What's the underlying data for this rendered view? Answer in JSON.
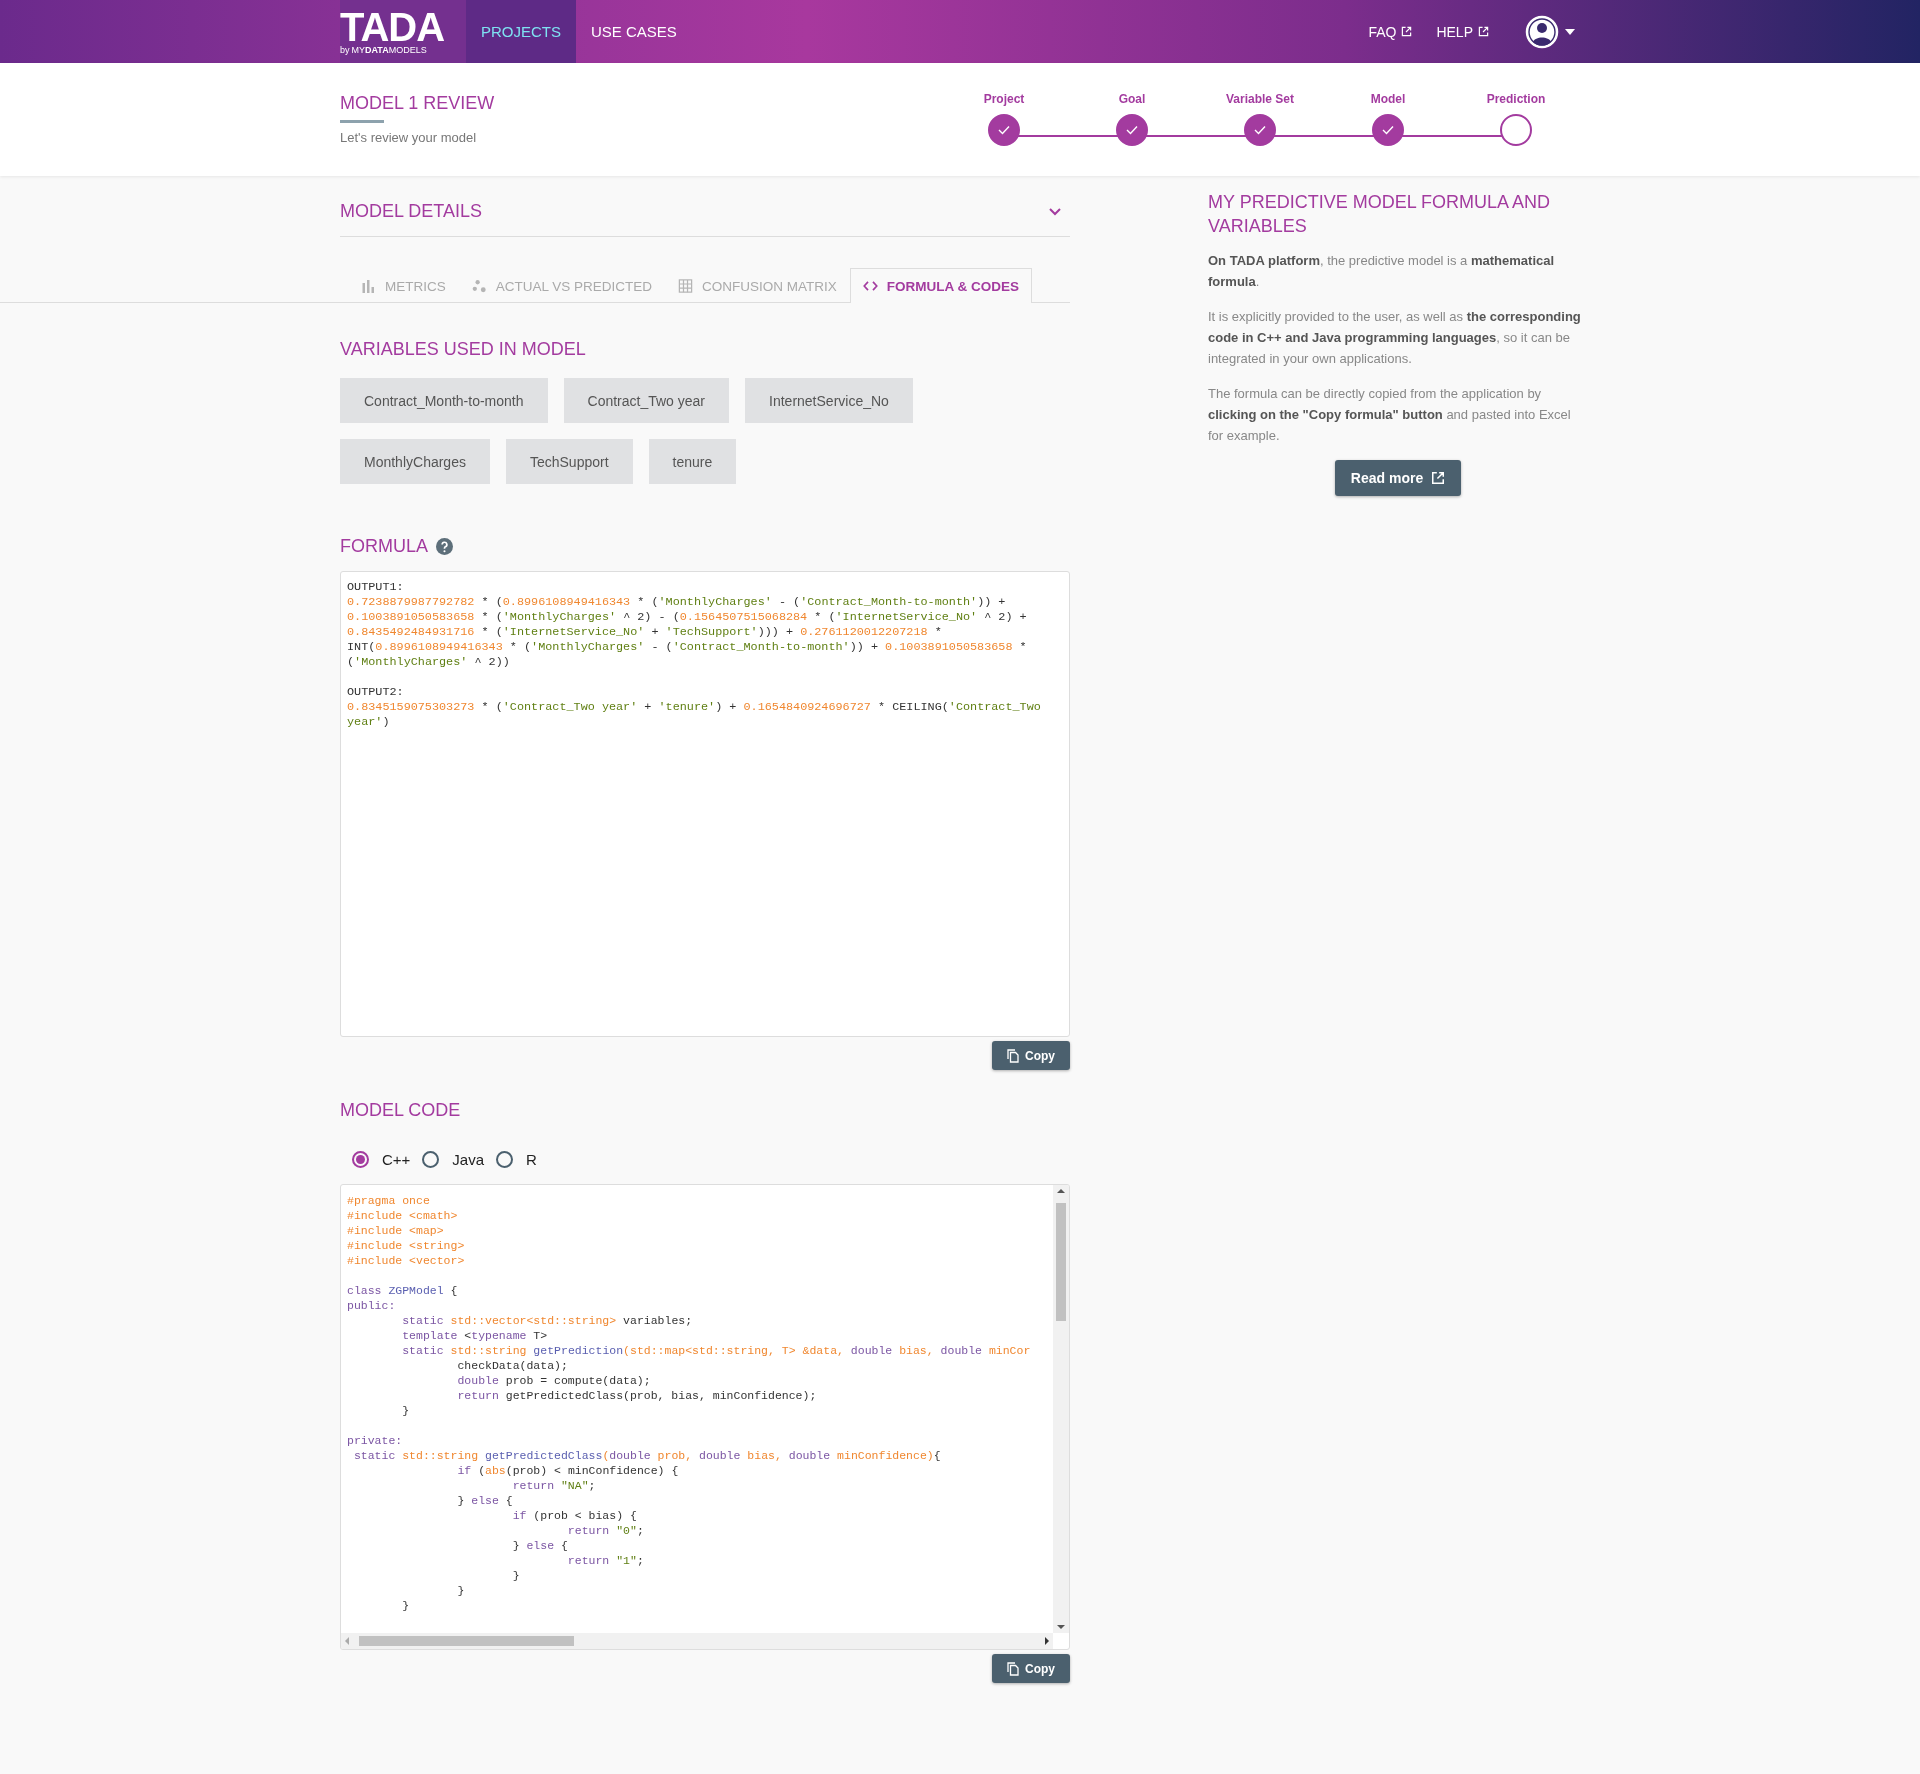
{
  "header": {
    "logo": {
      "name": "TADA",
      "by": "by",
      "tagline": "MY**DATA**MODELS"
    },
    "nav": [
      {
        "label": "PROJECTS",
        "selected": true
      },
      {
        "label": "USE CASES",
        "selected": false
      }
    ],
    "links": [
      "FAQ",
      "HELP"
    ]
  },
  "title": {
    "heading": "MODEL 1 REVIEW",
    "subtitle": "Let's review your model"
  },
  "steps": [
    {
      "label": "Project",
      "done": true
    },
    {
      "label": "Goal",
      "done": true
    },
    {
      "label": "Variable Set",
      "done": true
    },
    {
      "label": "Model",
      "done": true
    },
    {
      "label": "Prediction",
      "done": false
    }
  ],
  "details": {
    "title": "MODEL DETAILS",
    "expanded": true
  },
  "tabs": [
    {
      "label": "METRICS",
      "selected": false
    },
    {
      "label": "ACTUAL VS PREDICTED",
      "selected": false
    },
    {
      "label": "CONFUSION MATRIX",
      "selected": false
    },
    {
      "label": "FORMULA & CODES",
      "selected": true
    }
  ],
  "variables": {
    "title": "VARIABLES USED IN MODEL",
    "items": [
      "Contract_Month-to-month",
      "Contract_Two year",
      "InternetService_No",
      "MonthlyCharges",
      "TechSupport",
      "tenure"
    ]
  },
  "formula": {
    "title": "FORMULA",
    "copy": "Copy",
    "blocks": [
      [
        [
          {
            "kind": "plain",
            "text": "OUTPUT1:"
          }
        ],
        [
          {
            "kind": "number",
            "text": "0.7238879987792782"
          },
          {
            "kind": "plain",
            "text": " * ("
          },
          {
            "kind": "number",
            "text": "0.8996108949416343"
          },
          {
            "kind": "plain",
            "text": " * ("
          },
          {
            "kind": "string",
            "text": "'MonthlyCharges'"
          },
          {
            "kind": "plain",
            "text": " - ("
          },
          {
            "kind": "string",
            "text": "'Contract_Month-to-month'"
          },
          {
            "kind": "plain",
            "text": ")) +"
          }
        ],
        [
          {
            "kind": "number",
            "text": "0.1003891050583658"
          },
          {
            "kind": "plain",
            "text": " * ("
          },
          {
            "kind": "string",
            "text": "'MonthlyCharges'"
          },
          {
            "kind": "plain",
            "text": " ^ 2) - ("
          },
          {
            "kind": "number",
            "text": "0.1564507515068284"
          },
          {
            "kind": "plain",
            "text": " * ("
          },
          {
            "kind": "string",
            "text": "'InternetService_No'"
          },
          {
            "kind": "plain",
            "text": " ^ 2) +"
          }
        ],
        [
          {
            "kind": "number",
            "text": "0.8435492484931716"
          },
          {
            "kind": "plain",
            "text": " * ("
          },
          {
            "kind": "string",
            "text": "'InternetService_No'"
          },
          {
            "kind": "plain",
            "text": " + "
          },
          {
            "kind": "string",
            "text": "'TechSupport'"
          },
          {
            "kind": "plain",
            "text": "))) + "
          },
          {
            "kind": "number",
            "text": "0.2761120012207218"
          },
          {
            "kind": "plain",
            "text": " *"
          }
        ],
        [
          {
            "kind": "plain",
            "text": "INT("
          },
          {
            "kind": "number",
            "text": "0.8996108949416343"
          },
          {
            "kind": "plain",
            "text": " * ("
          },
          {
            "kind": "string",
            "text": "'MonthlyCharges'"
          },
          {
            "kind": "plain",
            "text": " - ("
          },
          {
            "kind": "string",
            "text": "'Contract_Month-to-month'"
          },
          {
            "kind": "plain",
            "text": ")) + "
          },
          {
            "kind": "number",
            "text": "0.1003891050583658"
          },
          {
            "kind": "plain",
            "text": " *"
          }
        ],
        [
          {
            "kind": "plain",
            "text": "("
          },
          {
            "kind": "string",
            "text": "'MonthlyCharges'"
          },
          {
            "kind": "plain",
            "text": " ^ 2))"
          }
        ]
      ],
      [
        [
          {
            "kind": "plain",
            "text": "OUTPUT2:"
          }
        ],
        [
          {
            "kind": "number",
            "text": "0.8345159075303273"
          },
          {
            "kind": "plain",
            "text": " * ("
          },
          {
            "kind": "string",
            "text": "'Contract_Two year'"
          },
          {
            "kind": "plain",
            "text": " + "
          },
          {
            "kind": "string",
            "text": "'tenure'"
          },
          {
            "kind": "plain",
            "text": ") + "
          },
          {
            "kind": "number",
            "text": "0.1654840924696727"
          },
          {
            "kind": "plain",
            "text": " * CEILING("
          },
          {
            "kind": "string",
            "text": "'Contract_Two"
          }
        ],
        [
          {
            "kind": "string",
            "text": "year'"
          },
          {
            "kind": "plain",
            "text": ")"
          }
        ]
      ]
    ]
  },
  "code": {
    "title": "MODEL CODE",
    "copy": "Copy",
    "languages": [
      {
        "label": "C++",
        "selected": true
      },
      {
        "label": "Java",
        "selected": false
      },
      {
        "label": "R",
        "selected": false
      }
    ],
    "blocks": [
      [
        [
          {
            "kind": "type",
            "text": "#pragma once"
          }
        ],
        [
          {
            "kind": "type",
            "text": "#include <cmath>"
          }
        ],
        [
          {
            "kind": "type",
            "text": "#include <map>"
          }
        ],
        [
          {
            "kind": "type",
            "text": "#include <string>"
          }
        ],
        [
          {
            "kind": "type",
            "text": "#include <vector>"
          }
        ]
      ],
      [
        [
          {
            "kind": "keyword",
            "text": "class"
          },
          {
            "kind": "name",
            "text": " ZGPModel"
          },
          {
            "kind": "plain",
            "text": " {"
          }
        ],
        [
          {
            "kind": "keyword",
            "text": "public:"
          }
        ],
        [
          {
            "kind": "keyword",
            "text": "\tstatic"
          },
          {
            "kind": "type",
            "text": " std::vector<std::string>"
          },
          {
            "kind": "plain",
            "text": " variables;"
          }
        ],
        [
          {
            "kind": "keyword",
            "text": "\ttemplate"
          },
          {
            "kind": "plain",
            "text": " <"
          },
          {
            "kind": "keyword",
            "text": "typename"
          },
          {
            "kind": "plain",
            "text": " T>"
          }
        ],
        [
          {
            "kind": "keyword",
            "text": "\tstatic"
          },
          {
            "kind": "type",
            "text": " std::string"
          },
          {
            "kind": "name",
            "text": " getPrediction"
          },
          {
            "kind": "type",
            "text": "(std::map<std::string, T> &data, "
          },
          {
            "kind": "keyword",
            "text": "double"
          },
          {
            "kind": "type",
            "text": " bias, "
          },
          {
            "kind": "keyword",
            "text": "double"
          },
          {
            "kind": "type",
            "text": " minCor"
          }
        ],
        [
          {
            "kind": "plain",
            "text": "\t\tcheckData(data);"
          }
        ],
        [
          {
            "kind": "keyword",
            "text": "\t\tdouble"
          },
          {
            "kind": "plain",
            "text": " prob = compute(data);"
          }
        ],
        [
          {
            "kind": "keyword",
            "text": "\t\treturn"
          },
          {
            "kind": "plain",
            "text": " getPredictedClass(prob, bias, minConfidence);"
          }
        ],
        [
          {
            "kind": "plain",
            "text": "\t}"
          }
        ]
      ],
      [
        [
          {
            "kind": "keyword",
            "text": "private:"
          }
        ],
        [
          {
            "kind": "keyword",
            "text": " static"
          },
          {
            "kind": "type",
            "text": " std::string"
          },
          {
            "kind": "name",
            "text": " getPredictedClass"
          },
          {
            "kind": "type",
            "text": "("
          },
          {
            "kind": "keyword",
            "text": "double"
          },
          {
            "kind": "type",
            "text": " prob, "
          },
          {
            "kind": "keyword",
            "text": "double"
          },
          {
            "kind": "type",
            "text": " bias, "
          },
          {
            "kind": "keyword",
            "text": "double"
          },
          {
            "kind": "type",
            "text": " minConfidence)"
          },
          {
            "kind": "plain",
            "text": "{"
          }
        ],
        [
          {
            "kind": "keyword",
            "text": "\t\tif"
          },
          {
            "kind": "plain",
            "text": " ("
          },
          {
            "kind": "type",
            "text": "abs"
          },
          {
            "kind": "plain",
            "text": "(prob) < minConfidence) {"
          }
        ],
        [
          {
            "kind": "keyword",
            "text": "\t\t\treturn"
          },
          {
            "kind": "string",
            "text": " \"NA\""
          },
          {
            "kind": "plain",
            "text": ";"
          }
        ],
        [
          {
            "kind": "plain",
            "text": "\t\t} "
          },
          {
            "kind": "keyword",
            "text": "else"
          },
          {
            "kind": "plain",
            "text": " {"
          }
        ],
        [
          {
            "kind": "keyword",
            "text": "\t\t\tif"
          },
          {
            "kind": "plain",
            "text": " (prob < bias) {"
          }
        ],
        [
          {
            "kind": "keyword",
            "text": "\t\t\t\treturn"
          },
          {
            "kind": "string",
            "text": " \"0\""
          },
          {
            "kind": "plain",
            "text": ";"
          }
        ],
        [
          {
            "kind": "plain",
            "text": "\t\t\t} "
          },
          {
            "kind": "keyword",
            "text": "else"
          },
          {
            "kind": "plain",
            "text": " {"
          }
        ],
        [
          {
            "kind": "keyword",
            "text": "\t\t\t\treturn"
          },
          {
            "kind": "string",
            "text": " \"1\""
          },
          {
            "kind": "plain",
            "text": ";"
          }
        ],
        [
          {
            "kind": "plain",
            "text": "\t\t\t}"
          }
        ],
        [
          {
            "kind": "plain",
            "text": "\t\t}"
          }
        ],
        [
          {
            "kind": "plain",
            "text": "\t}"
          }
        ]
      ]
    ]
  },
  "info": {
    "title": "MY PREDICTIVE MODEL FORMULA AND VARIABLES",
    "paragraphs": [
      "**On TADA platform**, the predictive model is a **mathematical formula**.",
      "It is explicitly provided to the user, as well as **the corresponding code in C++ and Java programming languages**, so it can be integrated in your own applications.",
      "The formula can be directly copied from the application by **clicking on the \"Copy formula\" button** and pasted into Excel for example."
    ],
    "button": "Read more"
  }
}
